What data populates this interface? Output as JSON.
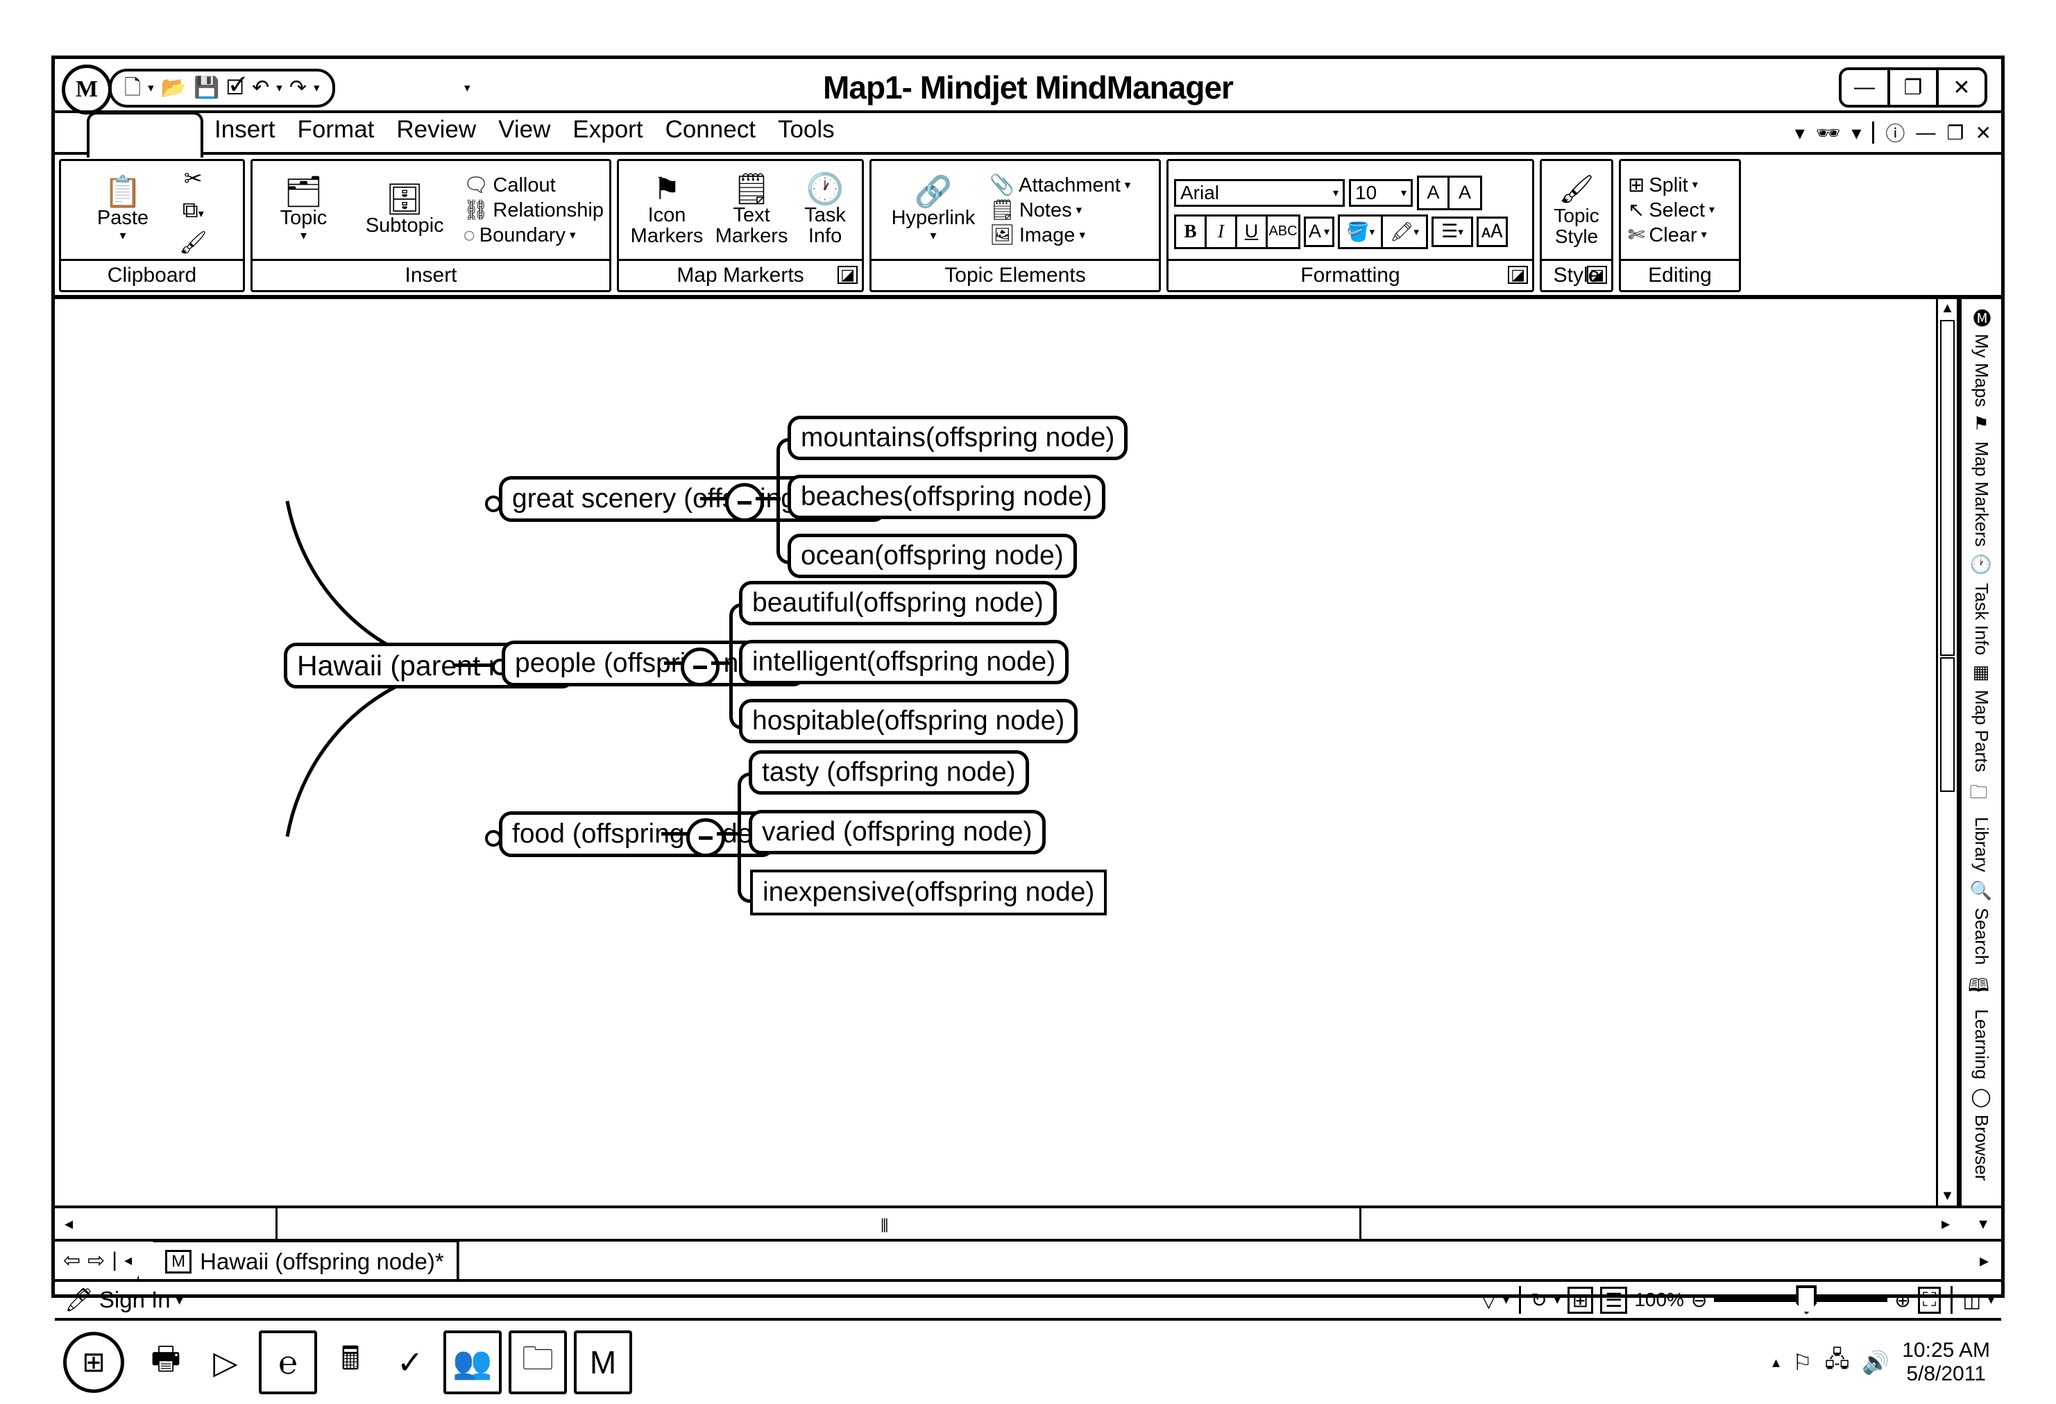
{
  "window": {
    "title": "Map1- Mindjet MindManager",
    "orb_label": "M",
    "minimize": "—",
    "restore": "❐",
    "close": "✕"
  },
  "quick_access": {
    "items": [
      {
        "name": "new-icon",
        "glyph": "🗋"
      },
      {
        "name": "open-icon",
        "glyph": "📂"
      },
      {
        "name": "save-icon",
        "glyph": "💾"
      },
      {
        "name": "check-icon",
        "glyph": "🗹"
      },
      {
        "name": "undo-icon",
        "glyph": "↶"
      },
      {
        "name": "redo-icon",
        "glyph": "↷"
      }
    ],
    "dropdown_caret": "▾",
    "overflow_caret": "▾"
  },
  "ribbon": {
    "tabs": [
      "Insert",
      "Format",
      "Review",
      "View",
      "Export",
      "Connect",
      "Tools"
    ],
    "active_tab": "",
    "right_controls": {
      "binoculars": "🕶",
      "caret": "▾",
      "help": "?",
      "minimize": "—",
      "restore": "❐",
      "close": "✕",
      "collapse_caret": "▾"
    },
    "groups": [
      {
        "name": "Clipboard",
        "label": "Clipboard",
        "big": {
          "label": "Paste",
          "caret": "▾"
        },
        "small": [
          {
            "label": "Cut",
            "icon": "✂"
          },
          {
            "label": "Copy",
            "icon": "⧉",
            "caret": "▾"
          },
          {
            "label": "Format Painter",
            "icon": "🖌"
          }
        ]
      },
      {
        "name": "Insert",
        "label": "Insert",
        "big_buttons": [
          {
            "label": "Topic",
            "caret": "▾"
          },
          {
            "label": "Subtopic",
            "caret": ""
          }
        ],
        "small": [
          {
            "label": "Callout",
            "caret": ""
          },
          {
            "label": "Relationship",
            "caret": ""
          },
          {
            "label": "Boundary",
            "caret": "▾"
          }
        ]
      },
      {
        "name": "Map Markerts",
        "label": "Map Markerts",
        "big_buttons": [
          {
            "label": "Icon Markers",
            "caret": "▾"
          },
          {
            "label": "Text Markers",
            "caret": "▾"
          },
          {
            "label": "Task Info",
            "caret": ""
          }
        ],
        "dialog_launcher": "◪"
      },
      {
        "name": "Topic Elements",
        "label": "Topic Elements",
        "big_buttons": [
          {
            "label": "Hyperlink",
            "caret": "▾"
          }
        ],
        "small": [
          {
            "label": "Attachment",
            "caret": "▾"
          },
          {
            "label": "Notes",
            "caret": "▾"
          },
          {
            "label": "Image",
            "caret": "▾"
          }
        ]
      },
      {
        "name": "Formatting",
        "label": "Formatting",
        "font_name": "Arial",
        "font_size": "10",
        "grow_font": "A",
        "shrink_font": "A",
        "buttons": [
          "B",
          "I",
          "U",
          "ABC"
        ],
        "dialog_launcher": "◪"
      },
      {
        "name": "Topic Style",
        "label": "Style",
        "lines": [
          "Topic",
          "Style"
        ],
        "dialog_launcher": "◪"
      },
      {
        "name": "Editing",
        "label": "Editing",
        "items": [
          {
            "label": "Split",
            "caret": "▾",
            "icon": "⊞"
          },
          {
            "label": "Select",
            "caret": "▾",
            "icon": "↖"
          },
          {
            "label": "Clear",
            "caret": "▾",
            "icon": "✄"
          }
        ]
      }
    ]
  },
  "mindmap": {
    "root": {
      "label": "Hawaii (parent node)"
    },
    "branches": [
      {
        "label": "great scenery (offspring node)",
        "collapse_sign": "−",
        "children": [
          "mountains(offspring node)",
          "beaches(offspring node)",
          "ocean(offspring node)"
        ]
      },
      {
        "label": "people (offspring node)",
        "collapse_sign": "−",
        "children": [
          "beautiful(offspring node)",
          "intelligent(offspring node)",
          "hospitable(offspring node)"
        ]
      },
      {
        "label": "food (offspring node)",
        "collapse_sign": "−",
        "children": [
          "tasty (offspring node)",
          "varied (offspring node)",
          "inexpensive(offspring node)"
        ],
        "selected_child_index": 2
      }
    ]
  },
  "side_panel": {
    "items": [
      "My Maps",
      "Map Markers",
      "Task Info",
      "Map Parts",
      "Library",
      "Search",
      "Learning",
      "Browser"
    ]
  },
  "document_tab": {
    "label": "Hawaii (offspring node)*",
    "icon": "M",
    "nav": {
      "back": "⇦",
      "forward": "⇨",
      "bar": "|",
      "caret": "◂"
    },
    "right_caret": "▸"
  },
  "status_bar": {
    "sign_in": "Sign In",
    "sign_in_caret": "▾",
    "filter_icon": "▽",
    "filter_caret": "▾",
    "refresh_icon": "↻",
    "refresh_caret": "▾",
    "view1_icon": "⊞",
    "view2_icon": "☰",
    "zoom_level": "100%",
    "zoom_out": "⊖",
    "zoom_in": "⊕",
    "fit_icon": "⛶",
    "panel_icon": "◫",
    "panel_caret": "▾"
  },
  "taskbar": {
    "start_icon": "⊞",
    "apps": [
      {
        "name": "printer-icon",
        "glyph": "🖶"
      },
      {
        "name": "media-player-icon",
        "glyph": "▷"
      },
      {
        "name": "internet-explorer-icon",
        "glyph": "℮"
      },
      {
        "name": "calculator-icon",
        "glyph": "🖩"
      },
      {
        "name": "check-icon",
        "glyph": "✓"
      },
      {
        "name": "people-icon",
        "glyph": "👥"
      },
      {
        "name": "folder-icon",
        "glyph": "🗀"
      },
      {
        "name": "mindmanager-icon",
        "glyph": "M"
      }
    ],
    "tray": {
      "caret": "▴",
      "flag_icon": "⚐",
      "network_icon": "🖧",
      "volume_icon": "🔊",
      "time": "10:25 AM",
      "date": "5/8/2011"
    }
  }
}
